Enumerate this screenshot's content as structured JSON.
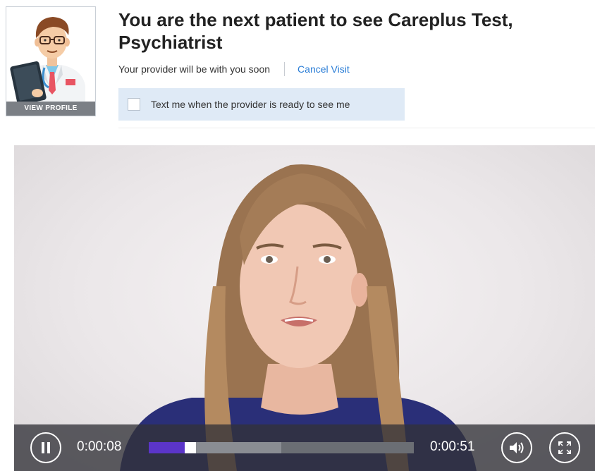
{
  "header": {
    "title": "You are the next patient to see Careplus Test, Psychiatrist",
    "status_text": "Your provider will be with you soon",
    "cancel_label": "Cancel Visit",
    "notify_label": "Text me when the provider is ready to see me",
    "notify_checked": false,
    "view_profile_label": "VIEW PROFILE"
  },
  "player": {
    "current_time": "0:00:08",
    "duration": "0:00:51",
    "progress": 0.157,
    "buffered": 0.5,
    "state": "playing",
    "accent_color": "#5b35c9"
  },
  "icons": {
    "pause": "pause-icon",
    "volume": "volume-icon",
    "fullscreen": "fullscreen-icon"
  }
}
